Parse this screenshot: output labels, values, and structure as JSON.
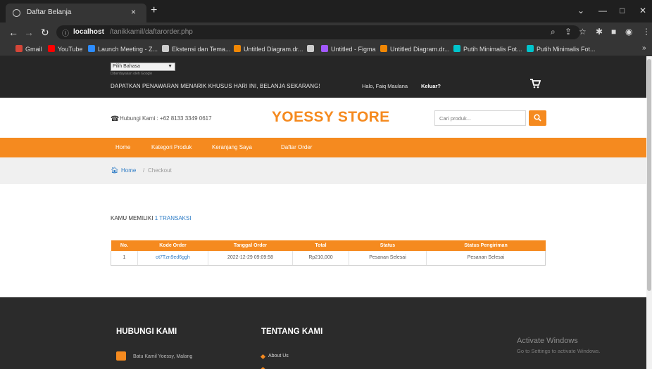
{
  "browser": {
    "tab_title": "Daftar Belanja",
    "tab_close": "×",
    "new_tab": "+",
    "url_host": "localhost",
    "url_path": "/tanikkamil/daftarorder.php",
    "window_controls": [
      "⌄",
      "—",
      "□",
      "✕"
    ],
    "bookmarks": [
      {
        "label": "Gmail",
        "color": "#d44638"
      },
      {
        "label": "YouTube",
        "color": "#ff0000"
      },
      {
        "label": "Launch Meeting - Z...",
        "color": "#2d8cff"
      },
      {
        "label": "Ekstensi dan Tema...",
        "color": "#cccccc"
      },
      {
        "label": "Untitled Diagram.dr...",
        "color": "#f08705"
      },
      {
        "label": "",
        "color": "#cccccc"
      },
      {
        "label": "Untitled - Figma",
        "color": "#a259ff"
      },
      {
        "label": "Untitled Diagram.dr...",
        "color": "#f08705"
      },
      {
        "label": "Putih Minimalis Fot...",
        "color": "#00c4cc"
      },
      {
        "label": "Putih Minimalis Fot...",
        "color": "#00c4cc"
      }
    ],
    "bookmarks_more": "»"
  },
  "topbar": {
    "language_select": "Pilih Bahasa",
    "powered_by": "Diberdayakan oleh Google",
    "promo": "DAPATKAN PENAWARAN MENARIK KHUSUS HARI INI, BELANJA SEKARANG!",
    "greeting": "Halo, Faiq Maulana",
    "logout": "Keluar?"
  },
  "header": {
    "contact": "Hubungi Kami : +62 8133 3349 0617",
    "brand": "YOESSY STORE",
    "search_placeholder": "Cari produk..."
  },
  "nav": [
    "Home",
    "Kategori Produk",
    "Keranjang Saya",
    "Daftar Order"
  ],
  "breadcrumb": {
    "home": "Home",
    "separator": "/",
    "current": "Checkout"
  },
  "content": {
    "summary_prefix": "KAMU MEMILIKI ",
    "summary_count": "1 TRANSAKSI",
    "table": {
      "headers": [
        "No.",
        "Kode Order",
        "Tanggal Order",
        "Total",
        "Status",
        "Status Pengiriman"
      ],
      "rows": [
        [
          "1",
          "ot7Tzn9ed6ggh",
          "2022-12-29 09:09:58",
          "Rp210,000",
          "Pesanan Selesai",
          "Pesanan Selesai"
        ]
      ]
    }
  },
  "footer": {
    "contact_title": "HUBUNGI KAMI",
    "about_title": "TENTANG KAMI",
    "address": "Batu Kamil Yoessy, Malang",
    "about_link": "About Us"
  },
  "watermark": {
    "line1": "Activate Windows",
    "line2": "Go to Settings to activate Windows."
  },
  "colors": {
    "accent": "#f58a1f",
    "link": "#2d7cc6",
    "dark": "#262626"
  }
}
